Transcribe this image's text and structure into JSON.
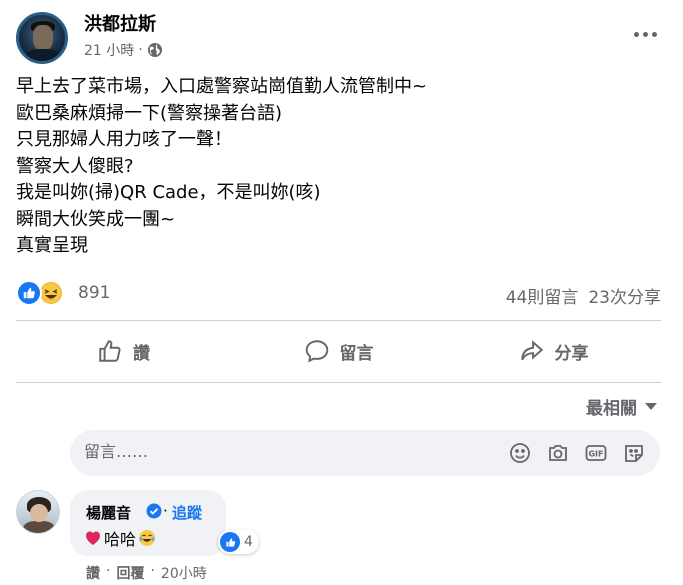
{
  "post": {
    "author": "洪都拉斯",
    "time": "21 小時",
    "meta_sep": "·",
    "body_lines": [
      "早上去了菜市場，入口處警察站崗值勤人流管制中~",
      "歐巴桑麻煩掃一下(警察操著台語)",
      "只見那婦人用力咳了一聲！",
      "警察大人傻眼?",
      "我是叫妳(掃)QR  Cade，不是叫妳(咳)",
      "瞬間大伙笑成一團~",
      "真實呈現"
    ],
    "privacy_icon": "globe-icon",
    "more_icon": "more-dots-icon"
  },
  "reactions": {
    "icons": [
      "like-icon",
      "haha-icon"
    ],
    "count": "891",
    "comments": "44則留言",
    "shares": "23次分享"
  },
  "actions": {
    "like_label": "讚",
    "comment_label": "留言",
    "share_label": "分享"
  },
  "sort": {
    "label": "最相關"
  },
  "comment_input": {
    "placeholder": "留言……",
    "icons": [
      "emoji-icon",
      "camera-icon",
      "gif-icon",
      "sticker-icon"
    ]
  },
  "comment": {
    "name": "楊麗音",
    "sep": "·",
    "follow": "追蹤",
    "text": "哈哈",
    "reaction_count": "4",
    "like_action": "讚",
    "reply_action": "回覆",
    "time": "20小時"
  },
  "colors": {
    "accent": "#1877f2",
    "secondary_text": "#65676b",
    "bubble_bg": "#f0f2f5",
    "divider": "#ced0d4"
  }
}
